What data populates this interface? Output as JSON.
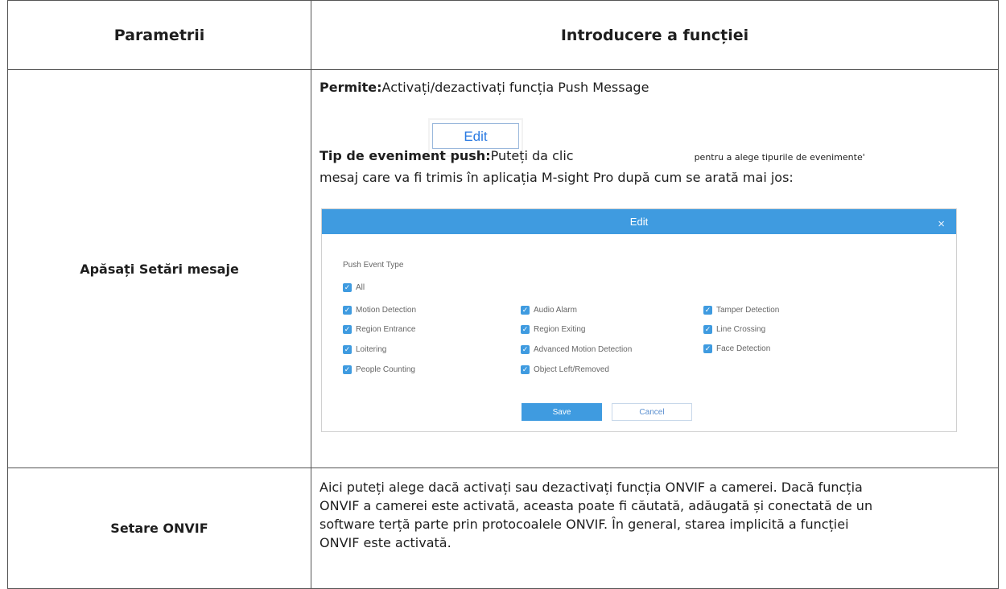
{
  "table": {
    "headers": {
      "param": "Parametrii",
      "desc": "Introducere a funcției"
    },
    "rows": {
      "push": {
        "param": "Apăsați Setări mesaje",
        "enable_label": "Permite:",
        "enable_text": "Activați/dezactivați funcția Push Message",
        "push_label": "Tip de eveniment push:",
        "push_text_before": "Puteți da clic",
        "edit_button_label": "Edit",
        "push_text_after": "pentru a alege tipurile de evenimente'",
        "push_text_line2": "mesaj care va fi trimis în aplicația M-sight Pro după cum se arată mai jos:",
        "dialog": {
          "title": "Edit",
          "close_glyph": "×",
          "section_label": "Push Event Type",
          "check_glyph": "✓",
          "all_label": "All",
          "options": [
            "Motion Detection",
            "Audio Alarm",
            "Tamper Detection",
            "Region Entrance",
            "Region Exiting",
            "Line Crossing",
            "Loitering",
            "Advanced Motion Detection",
            "Face Detection",
            "People Counting",
            "Object Left/Removed"
          ],
          "save_label": "Save",
          "cancel_label": "Cancel",
          "accent_color": "#3f9be0"
        }
      },
      "onvif": {
        "param": "Setare ONVIF",
        "lines": [
          "Aici puteți alege dacă activați sau dezactivați funcția ONVIF a camerei. Dacă funcția",
          "ONVIF a camerei este activată, aceasta poate fi căutată, adăugată și conectată de un",
          "software terță parte prin protocoalele ONVIF. În general, starea implicită a funcției",
          "ONVIF este activată."
        ]
      }
    }
  }
}
